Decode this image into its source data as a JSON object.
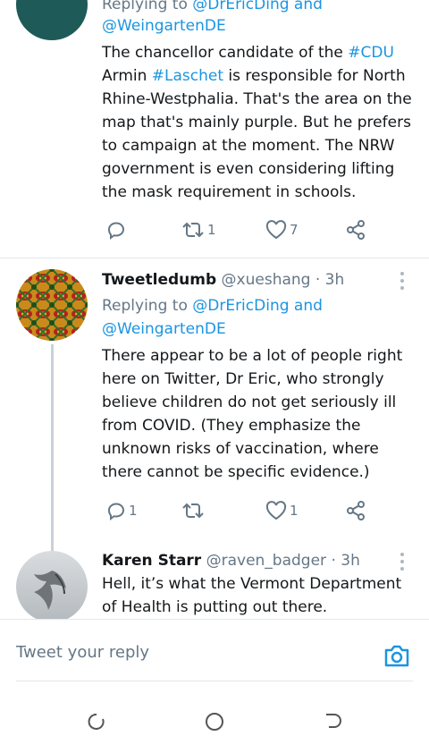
{
  "tweet1": {
    "reply_to_label": "Replying to",
    "reply_to_handle1": "@DrEricDing",
    "reply_to_and": "and",
    "reply_to_handle2": "@WeingartenDE",
    "text_segments": [
      "The chancellor candidate of the ",
      "#CDU",
      " Armin ",
      "#Laschet",
      " is responsible for North Rhine-Westphalia. That's the area on the map that's mainly purple. But he prefers to campaign at the moment. The NRW government is even considering lifting the mask requirement in schools."
    ],
    "replies": "",
    "retweets": "1",
    "likes": "7"
  },
  "tweet2": {
    "name": "Tweetledumb",
    "handle": "@xueshang",
    "time": "· 3h",
    "reply_to_label": "Replying to",
    "reply_to_handle1": "@DrEricDing",
    "reply_to_and": "and",
    "reply_to_handle2": "@WeingartenDE",
    "text": "There appear to be a lot of people right here on Twitter, Dr Eric, who strongly believe children do not get seriously ill from COVID. (They emphasize the unknown risks of vaccination, where there cannot be specific evidence.)",
    "replies": "1",
    "retweets": "",
    "likes": "1"
  },
  "tweet3": {
    "name": "Karen Starr",
    "handle": "@raven_badger",
    "time": "· 3h",
    "text": "Hell, it’s what the Vermont Department of Health is putting out there."
  },
  "reply_bar": {
    "placeholder": "Tweet your reply"
  },
  "colors": {
    "link": "#1b95e0",
    "secondary_text": "#657786",
    "divider": "#e1e8ed"
  }
}
